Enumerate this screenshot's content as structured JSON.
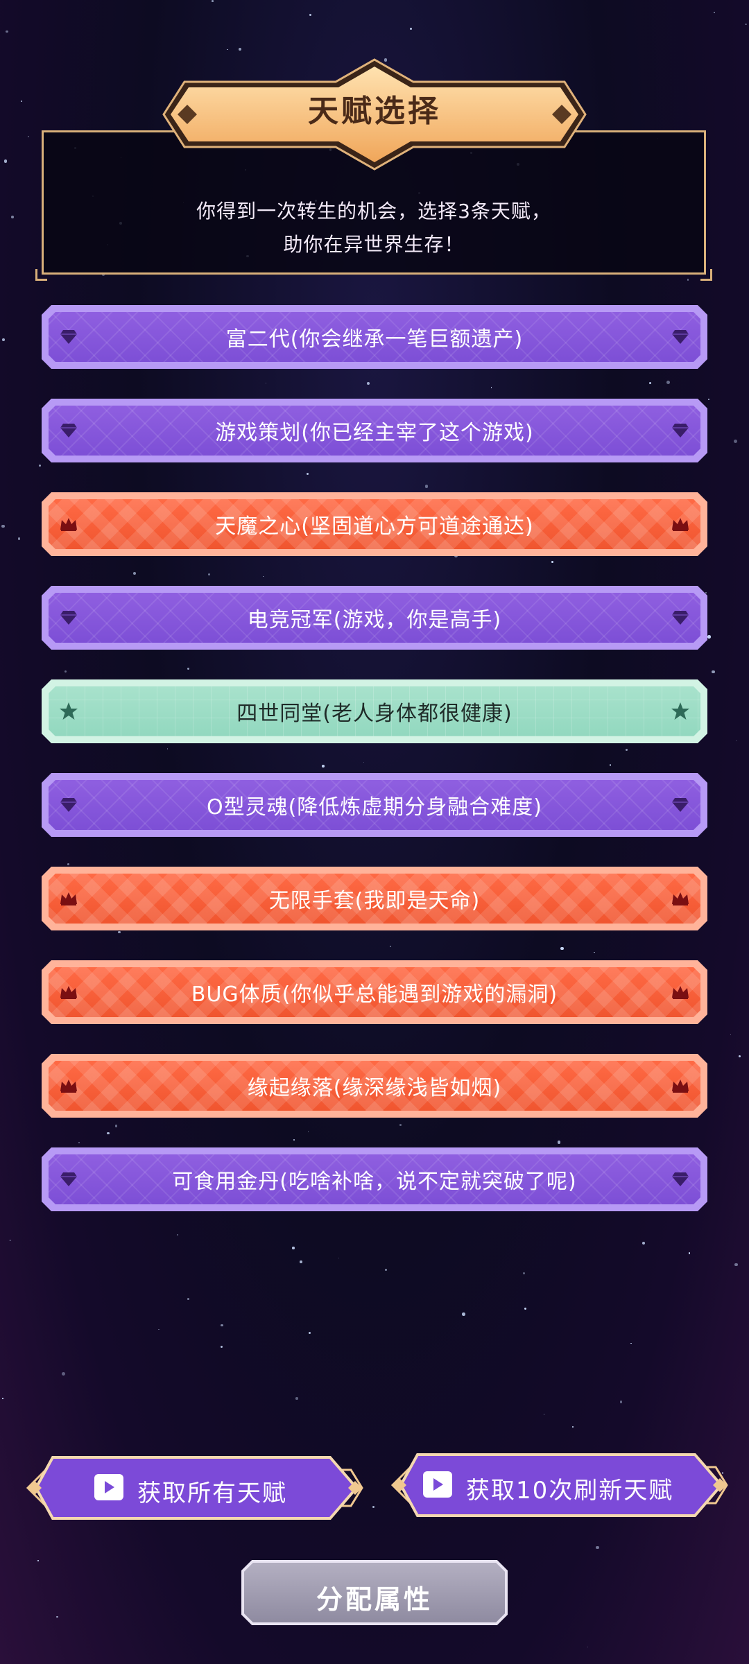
{
  "header": {
    "title": "天赋选择",
    "description_line1": "你得到一次转生的机会，选择3条天赋，",
    "description_line2": "助你在异世界生存！"
  },
  "rarity_colors": {
    "purple": "#8f5fe0",
    "red": "#f0552f",
    "green": "#a8e2cc"
  },
  "talents": [
    {
      "label": "富二代(你会继承一笔巨额遗产)",
      "rarity": "purple",
      "icon": "gem-icon"
    },
    {
      "label": "游戏策划(你已经主宰了这个游戏)",
      "rarity": "purple",
      "icon": "gem-icon"
    },
    {
      "label": "天魔之心(坚固道心方可道途通达)",
      "rarity": "red",
      "icon": "crown-icon"
    },
    {
      "label": "电竞冠军(游戏，你是高手)",
      "rarity": "purple",
      "icon": "gem-icon"
    },
    {
      "label": "四世同堂(老人身体都很健康)",
      "rarity": "green",
      "icon": "star-icon"
    },
    {
      "label": "O型灵魂(降低炼虚期分身融合难度)",
      "rarity": "purple",
      "icon": "gem-icon"
    },
    {
      "label": "无限手套(我即是天命)",
      "rarity": "red",
      "icon": "crown-icon"
    },
    {
      "label": "BUG体质(你似乎总能遇到游戏的漏洞)",
      "rarity": "red",
      "icon": "crown-icon"
    },
    {
      "label": "缘起缘落(缘深缘浅皆如烟)",
      "rarity": "red",
      "icon": "crown-icon"
    },
    {
      "label": "可食用金丹(吃啥补啥，说不定就突破了呢)",
      "rarity": "purple",
      "icon": "gem-icon"
    }
  ],
  "buttons": {
    "get_all_talents": "获取所有天赋",
    "get_refresh": "获取10次刷新天赋",
    "assign_attributes": "分配属性"
  }
}
